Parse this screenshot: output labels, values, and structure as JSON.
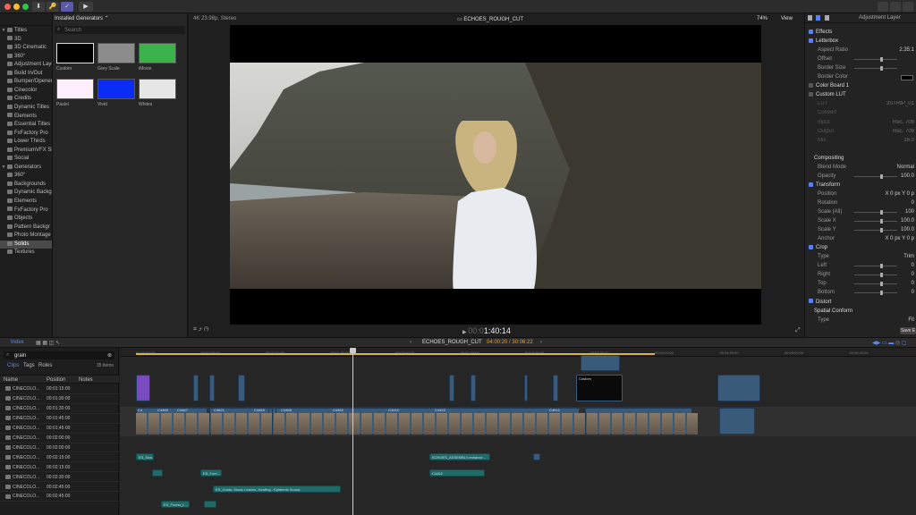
{
  "topbar": {
    "buttons": [
      "⬇",
      "🔑",
      "✓",
      "▶"
    ],
    "right_icons": [
      "grid-icon",
      "panels-icon",
      "sliders-icon"
    ]
  },
  "library": {
    "items": [
      {
        "label": "Titles",
        "level": 0,
        "expanded": true
      },
      {
        "label": "3D",
        "level": 1
      },
      {
        "label": "3D Cinematic",
        "level": 1
      },
      {
        "label": "360°",
        "level": 1
      },
      {
        "label": "Adjustment Layer",
        "level": 1
      },
      {
        "label": "Build In/Out",
        "level": 1
      },
      {
        "label": "Bumper/Opener",
        "level": 1
      },
      {
        "label": "Cinecolor",
        "level": 1
      },
      {
        "label": "Credits",
        "level": 1
      },
      {
        "label": "Dynamic Titles",
        "level": 1
      },
      {
        "label": "Elements",
        "level": 1
      },
      {
        "label": "Essential Titles",
        "level": 1
      },
      {
        "label": "FxFactory Pro",
        "level": 1
      },
      {
        "label": "Lower Thirds",
        "level": 1
      },
      {
        "label": "PremiumVFX Si",
        "level": 1
      },
      {
        "label": "Social",
        "level": 1
      },
      {
        "label": "Generators",
        "level": 0,
        "expanded": true
      },
      {
        "label": "360°",
        "level": 1
      },
      {
        "label": "Backgrounds",
        "level": 1
      },
      {
        "label": "Dynamic Backg",
        "level": 1
      },
      {
        "label": "Elements",
        "level": 1
      },
      {
        "label": "FxFactory Pro",
        "level": 1
      },
      {
        "label": "Objects",
        "level": 1
      },
      {
        "label": "Pattern Backgr",
        "level": 1
      },
      {
        "label": "Photo Montage",
        "level": 1
      },
      {
        "label": "Solids",
        "level": 1,
        "selected": true
      },
      {
        "label": "Textures",
        "level": 1
      }
    ]
  },
  "generators": {
    "header": "Installed Generators",
    "search_placeholder": "Search",
    "swatches": [
      {
        "label": "Custom",
        "color": "#000000"
      },
      {
        "label": "Grey Scale",
        "color": "#8c8c8c"
      },
      {
        "label": "iMovie",
        "color": "#3bb34a"
      },
      {
        "label": "Pastel",
        "color": "#ffeefc"
      },
      {
        "label": "Vivid",
        "color": "#0a2cf5"
      },
      {
        "label": "Whites",
        "color": "#e6e6e6"
      }
    ]
  },
  "viewer": {
    "format": "4K 23.98p, Stereo",
    "title": "ECHOES_ROUGH_CUT",
    "zoom": "74%",
    "view_menu": "View",
    "timecode_dim": "00:0",
    "timecode": "1:40:14"
  },
  "inspector": {
    "title": "Adjustment Layer",
    "rows": [
      {
        "label": "Effects",
        "type": "check"
      },
      {
        "label": "Letterbox",
        "type": "check"
      },
      {
        "label": "Aspect Ratio",
        "type": "param",
        "value": "2.35:1"
      },
      {
        "label": "Offset",
        "type": "slider"
      },
      {
        "label": "Border Size",
        "type": "slider"
      },
      {
        "label": "Border Color",
        "type": "color"
      },
      {
        "label": "Color Board 1",
        "type": "checkoff"
      },
      {
        "label": "Custom LUT",
        "type": "checkoff"
      },
      {
        "label": "LUT",
        "type": "dim",
        "value": "3STRIP_01"
      },
      {
        "label": "Convert",
        "type": "dim"
      },
      {
        "label": "Input",
        "type": "dim",
        "value": "Rec. 709"
      },
      {
        "label": "Output",
        "type": "dim",
        "value": "Rec. 709"
      },
      {
        "label": "Mix",
        "type": "dim",
        "value": "16.0"
      },
      {
        "label": "",
        "type": "blank"
      },
      {
        "label": "Compositing",
        "type": "header"
      },
      {
        "label": "Blend Mode",
        "type": "param",
        "value": "Normal"
      },
      {
        "label": "Opacity",
        "type": "slider",
        "value": "100.0"
      },
      {
        "label": "Transform",
        "type": "check"
      },
      {
        "label": "Position",
        "type": "param",
        "value": "X  0 px   Y  0 p"
      },
      {
        "label": "Rotation",
        "type": "param",
        "value": "0"
      },
      {
        "label": "Scale (All)",
        "type": "slider",
        "value": "100"
      },
      {
        "label": "Scale X",
        "type": "slider",
        "value": "100.0"
      },
      {
        "label": "Scale Y",
        "type": "slider",
        "value": "100.0"
      },
      {
        "label": "Anchor",
        "type": "param",
        "value": "X  0 px   Y  0 p"
      },
      {
        "label": "Crop",
        "type": "check"
      },
      {
        "label": "Type",
        "type": "param",
        "value": "Trim"
      },
      {
        "label": "Left",
        "type": "slider",
        "value": "0"
      },
      {
        "label": "Right",
        "type": "slider",
        "value": "0"
      },
      {
        "label": "Top",
        "type": "slider",
        "value": "0"
      },
      {
        "label": "Bottom",
        "type": "slider",
        "value": "0"
      },
      {
        "label": "Distort",
        "type": "check"
      },
      {
        "label": "Spatial Conform",
        "type": "header"
      },
      {
        "label": "Type",
        "type": "param",
        "value": "Fit"
      }
    ],
    "save_label": "Save E"
  },
  "timeline_bar": {
    "index_label": "Index",
    "project": "ECHOES_ROUGH_CUT",
    "duration": "04:00:20 / 30:06:22"
  },
  "clips_panel": {
    "search_value": "grain",
    "tabs": [
      "Clips",
      "Tags",
      "Roles"
    ],
    "count": "35 items",
    "columns": [
      "Name",
      "Position",
      "Notes"
    ],
    "rows": [
      {
        "name": "CINECOLO...",
        "position": "00:01:15:00"
      },
      {
        "name": "CINECOLO...",
        "position": "00:01:30:00"
      },
      {
        "name": "CINECOLO...",
        "position": "00:01:30:00"
      },
      {
        "name": "CINECOLO...",
        "position": "00:01:45:00"
      },
      {
        "name": "CINECOLO...",
        "position": "00:01:45:00"
      },
      {
        "name": "CINECOLO...",
        "position": "00:02:00:00"
      },
      {
        "name": "CINECOLO...",
        "position": "00:02:00:00"
      },
      {
        "name": "CINECOLO...",
        "position": "00:02:15:00"
      },
      {
        "name": "CINECOLO...",
        "position": "00:02:15:00"
      },
      {
        "name": "CINECOLO...",
        "position": "00:02:30:00"
      },
      {
        "name": "CINECOLO...",
        "position": "00:02:45:00"
      },
      {
        "name": "CINECOLO...",
        "position": "00:02:45:00"
      }
    ]
  },
  "timeline": {
    "ruler": [
      "00:00:00:00",
      "00:00:30:00",
      "00:01:00:00",
      "00:01:30:00",
      "00:02:00:00",
      "00:02:30:00",
      "00:03:00:00",
      "00:03:30:00",
      "00:04:00:00",
      "00:04:30:00",
      "00:05:00:00",
      "00:05:30:00"
    ],
    "custom_label": "Custom",
    "clip_labels": [
      "C4",
      "C4465",
      "C4467",
      "C4621",
      "C4463",
      "C4468",
      "C4462",
      "C4410",
      "C4423",
      "C4612"
    ],
    "audio_clips": [
      "ES_Sea...",
      "ES_Fore...",
      "ES_Gusts, Snow, Leaves, Howling - Epidemic Sound",
      "ECHOES_ASSEMBLY-enhance...",
      "C4462",
      "ES_Forest_L..."
    ]
  }
}
